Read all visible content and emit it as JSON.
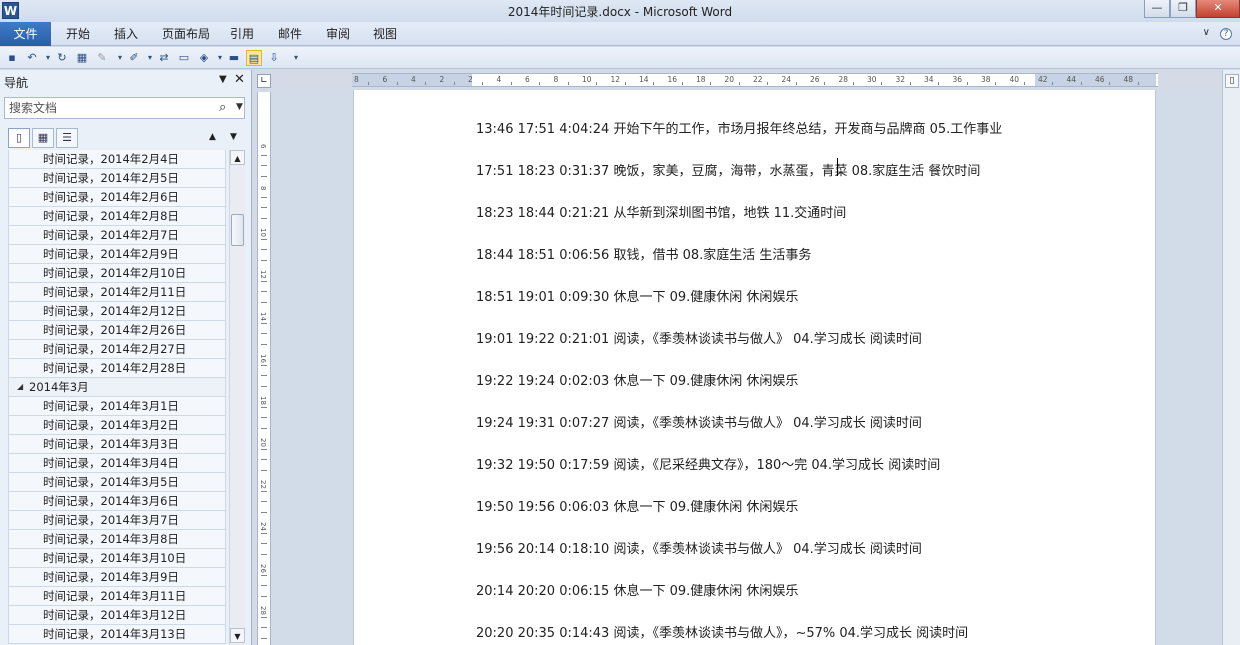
{
  "window": {
    "title": "2014年时间记录.docx - Microsoft Word",
    "app_icon_letter": "W",
    "minimize": "—",
    "restore": "❐",
    "close": "✕"
  },
  "ribbon": {
    "tabs": [
      {
        "label": "文件"
      },
      {
        "label": "开始"
      },
      {
        "label": "插入"
      },
      {
        "label": "页面布局"
      },
      {
        "label": "引用"
      },
      {
        "label": "邮件"
      },
      {
        "label": "审阅"
      },
      {
        "label": "视图"
      }
    ],
    "help": "?",
    "collapse": "∨"
  },
  "nav": {
    "title": "导航",
    "search_placeholder": "搜索文档",
    "headings": [
      {
        "label": "时间记录，2014年2月4日",
        "level": 2
      },
      {
        "label": "时间记录，2014年2月5日",
        "level": 2
      },
      {
        "label": "时间记录，2014年2月6日",
        "level": 2
      },
      {
        "label": "时间记录，2014年2月8日",
        "level": 2
      },
      {
        "label": "时间记录，2014年2月7日",
        "level": 2
      },
      {
        "label": "时间记录，2014年2月9日",
        "level": 2
      },
      {
        "label": "时间记录，2014年2月10日",
        "level": 2
      },
      {
        "label": "时间记录，2014年2月11日",
        "level": 2
      },
      {
        "label": "时间记录，2014年2月12日",
        "level": 2
      },
      {
        "label": "时间记录，2014年2月26日",
        "level": 2
      },
      {
        "label": "时间记录，2014年2月27日",
        "level": 2
      },
      {
        "label": "时间记录，2014年2月28日",
        "level": 2
      },
      {
        "label": "2014年3月",
        "level": 1
      },
      {
        "label": "时间记录，2014年3月1日",
        "level": 2
      },
      {
        "label": "时间记录，2014年3月2日",
        "level": 2
      },
      {
        "label": "时间记录，2014年3月3日",
        "level": 2
      },
      {
        "label": "时间记录，2014年3月4日",
        "level": 2
      },
      {
        "label": "时间记录，2014年3月5日",
        "level": 2
      },
      {
        "label": "时间记录，2014年3月6日",
        "level": 2
      },
      {
        "label": "时间记录，2014年3月7日",
        "level": 2
      },
      {
        "label": "时间记录，2014年3月8日",
        "level": 2
      },
      {
        "label": "时间记录，2014年3月10日",
        "level": 2
      },
      {
        "label": "时间记录，2014年3月9日",
        "level": 2
      },
      {
        "label": "时间记录，2014年3月11日",
        "level": 2
      },
      {
        "label": "时间记录，2014年3月12日",
        "level": 2
      },
      {
        "label": "时间记录，2014年3月13日",
        "level": 2
      }
    ]
  },
  "ruler": {
    "h_labels": [
      "8",
      "6",
      "4",
      "2",
      "2",
      "4",
      "6",
      "8",
      "10",
      "12",
      "14",
      "16",
      "18",
      "20",
      "22",
      "24",
      "26",
      "28",
      "30",
      "32",
      "34",
      "36",
      "38",
      "40",
      "42",
      "44",
      "46",
      "48"
    ],
    "v_labels": [
      "6",
      "8",
      "10",
      "12",
      "14",
      "16",
      "18",
      "20",
      "22",
      "24",
      "26",
      "28"
    ]
  },
  "document": {
    "lines": [
      "13:46 17:51 4:04:24  开始下午的工作，市场月报年终总结，开发商与品牌商  05.工作事业",
      "17:51 18:23 0:31:37  晚饭，家美，豆腐，海带，水蒸蛋，青菜   08.家庭生活  餐饮时间",
      "18:23 18:44 0:21:21  从华新到深圳图书馆，地铁   11.交通时间",
      "18:44 18:51 0:06:56  取钱，借书  08.家庭生活  生活事务",
      "18:51 19:01 0:09:30  休息一下  09.健康休闲  休闲娱乐",
      "19:01 19:22 0:21:01  阅读，《季羡林谈读书与做人》   04.学习成长  阅读时间",
      "19:22 19:24 0:02:03  休息一下  09.健康休闲  休闲娱乐",
      "19:24 19:31 0:07:27  阅读，《季羡林谈读书与做人》   04.学习成长  阅读时间",
      "19:32 19:50 0:17:59  阅读，《尼采经典文存》，180～完   04.学习成长  阅读时间",
      "19:50 19:56 0:06:03  休息一下  09.健康休闲  休闲娱乐",
      "19:56 20:14 0:18:10  阅读，《季羡林谈读书与做人》   04.学习成长  阅读时间",
      "20:14 20:20 0:06:15  休息一下  09.健康休闲  休闲娱乐",
      "20:20 20:35 0:14:43  阅读，《季羡林谈读书与做人》，~57%  04.学习成长  阅读时间"
    ]
  }
}
